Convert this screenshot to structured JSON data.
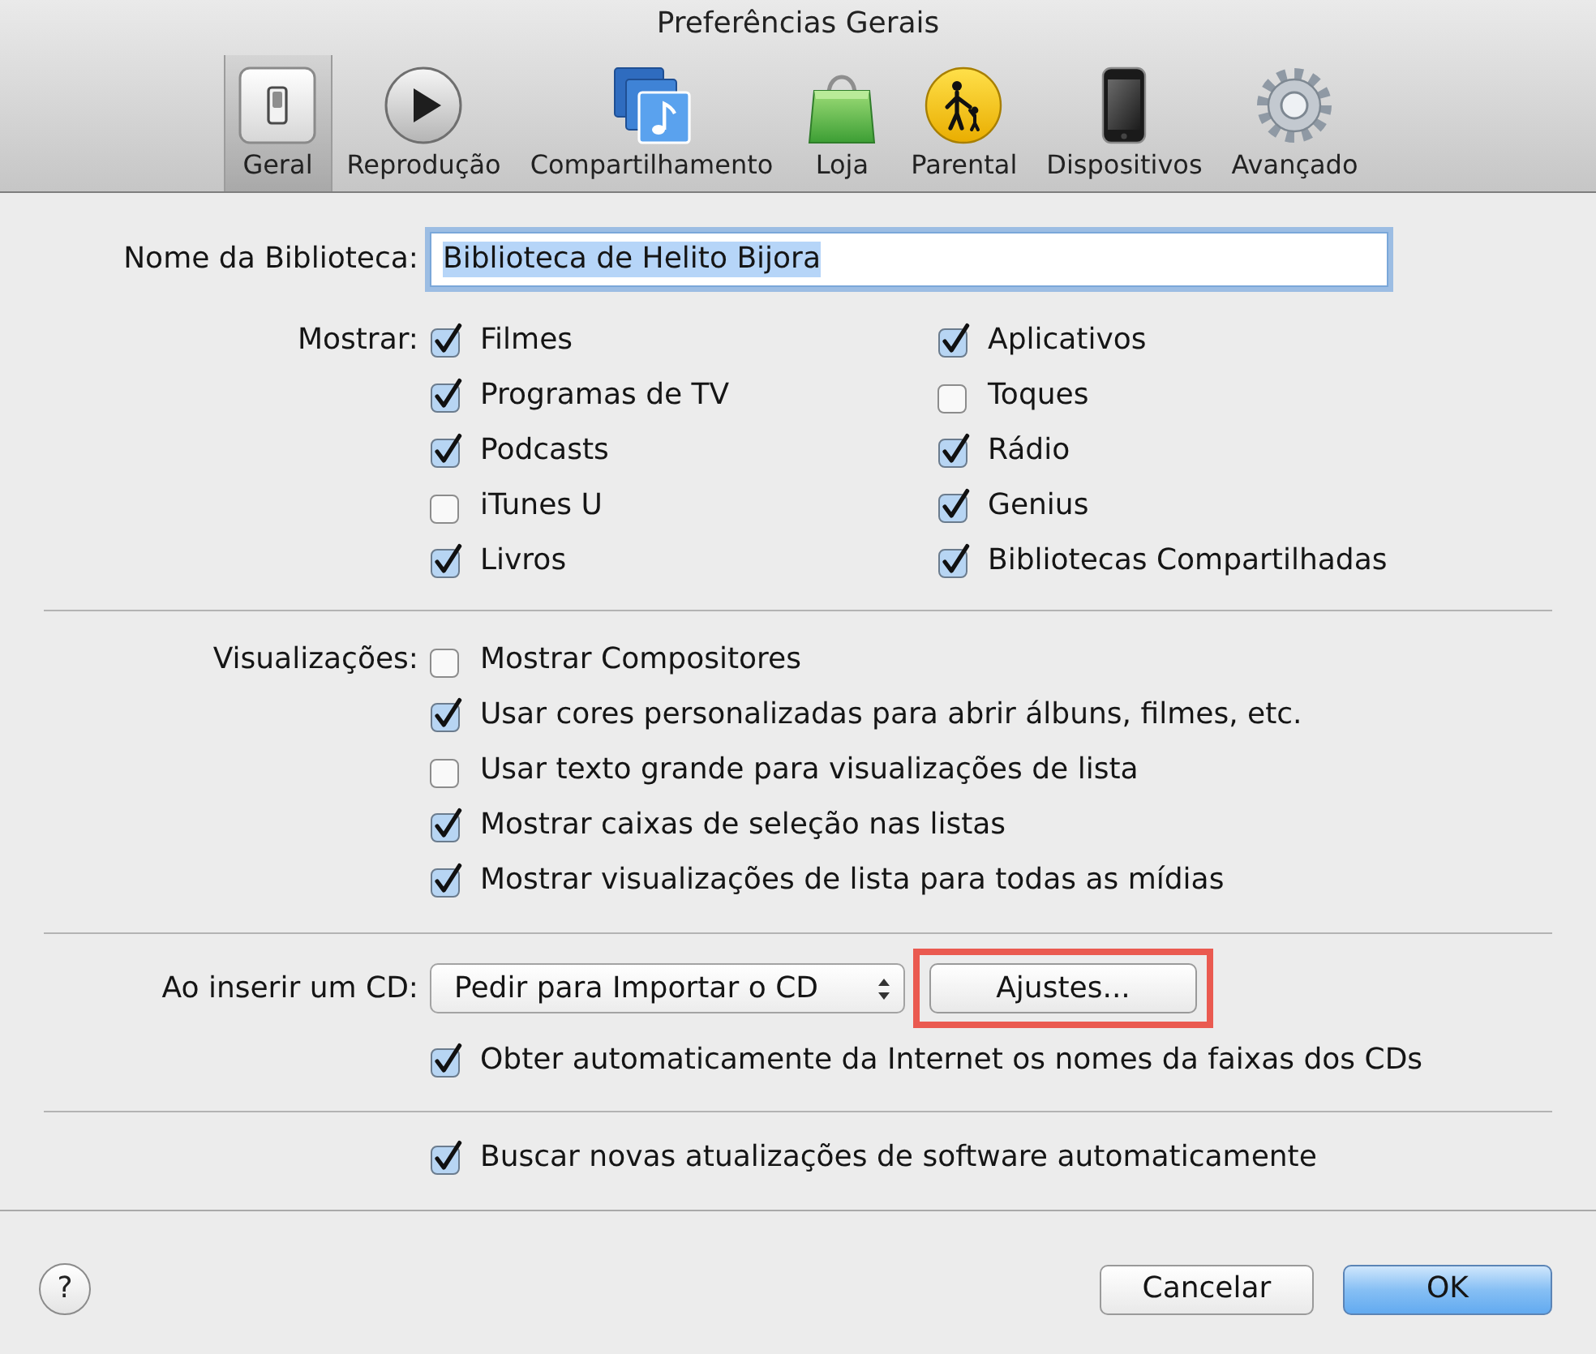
{
  "window": {
    "title": "Preferências Gerais"
  },
  "toolbar": [
    {
      "label": "Geral",
      "kind": "switch",
      "selected": true
    },
    {
      "label": "Reprodução",
      "kind": "play",
      "selected": false
    },
    {
      "label": "Compartilhamento",
      "kind": "sharing",
      "selected": false
    },
    {
      "label": "Loja",
      "kind": "bag",
      "selected": false
    },
    {
      "label": "Parental",
      "kind": "parental",
      "selected": false
    },
    {
      "label": "Dispositivos",
      "kind": "phone",
      "selected": false
    },
    {
      "label": "Avançado",
      "kind": "gear",
      "selected": false
    }
  ],
  "library_name": {
    "label": "Nome da Biblioteca:",
    "value": "Biblioteca de Helito Bijora",
    "focused": true,
    "text_selected": true
  },
  "show": {
    "label": "Mostrar:",
    "columns": [
      [
        {
          "label": "Filmes",
          "checked": true
        },
        {
          "label": "Programas de TV",
          "checked": true
        },
        {
          "label": "Podcasts",
          "checked": true
        },
        {
          "label": "iTunes U",
          "checked": false
        },
        {
          "label": "Livros",
          "checked": true
        }
      ],
      [
        {
          "label": "Aplicativos",
          "checked": true
        },
        {
          "label": "Toques",
          "checked": false
        },
        {
          "label": "Rádio",
          "checked": true
        },
        {
          "label": "Genius",
          "checked": true
        },
        {
          "label": "Bibliotecas Compartilhadas",
          "checked": true
        }
      ]
    ]
  },
  "views": {
    "label": "Visualizações:",
    "options": [
      {
        "label": "Mostrar Compositores",
        "checked": false
      },
      {
        "label": "Usar cores personalizadas para abrir álbuns, filmes, etc.",
        "checked": true
      },
      {
        "label": "Usar texto grande para visualizações de lista",
        "checked": false
      },
      {
        "label": "Mostrar caixas de seleção nas listas",
        "checked": true
      },
      {
        "label": "Mostrar visualizações de lista para todas as mídias",
        "checked": true
      }
    ]
  },
  "cd": {
    "label": "Ao inserir um CD:",
    "action": "Pedir para Importar o CD",
    "settings_button": {
      "label": "Ajustes...",
      "highlighted": true
    },
    "options": [
      {
        "label": "Obter automaticamente da Internet os nomes da faixas dos CDs",
        "checked": true
      }
    ]
  },
  "updates": {
    "options": [
      {
        "label": "Buscar novas atualizações de software automaticamente",
        "checked": true
      }
    ]
  },
  "footer": {
    "help": "?",
    "buttons": [
      {
        "label": "Cancelar",
        "kind": "cancel"
      },
      {
        "label": "OK",
        "kind": "confirm"
      }
    ]
  }
}
